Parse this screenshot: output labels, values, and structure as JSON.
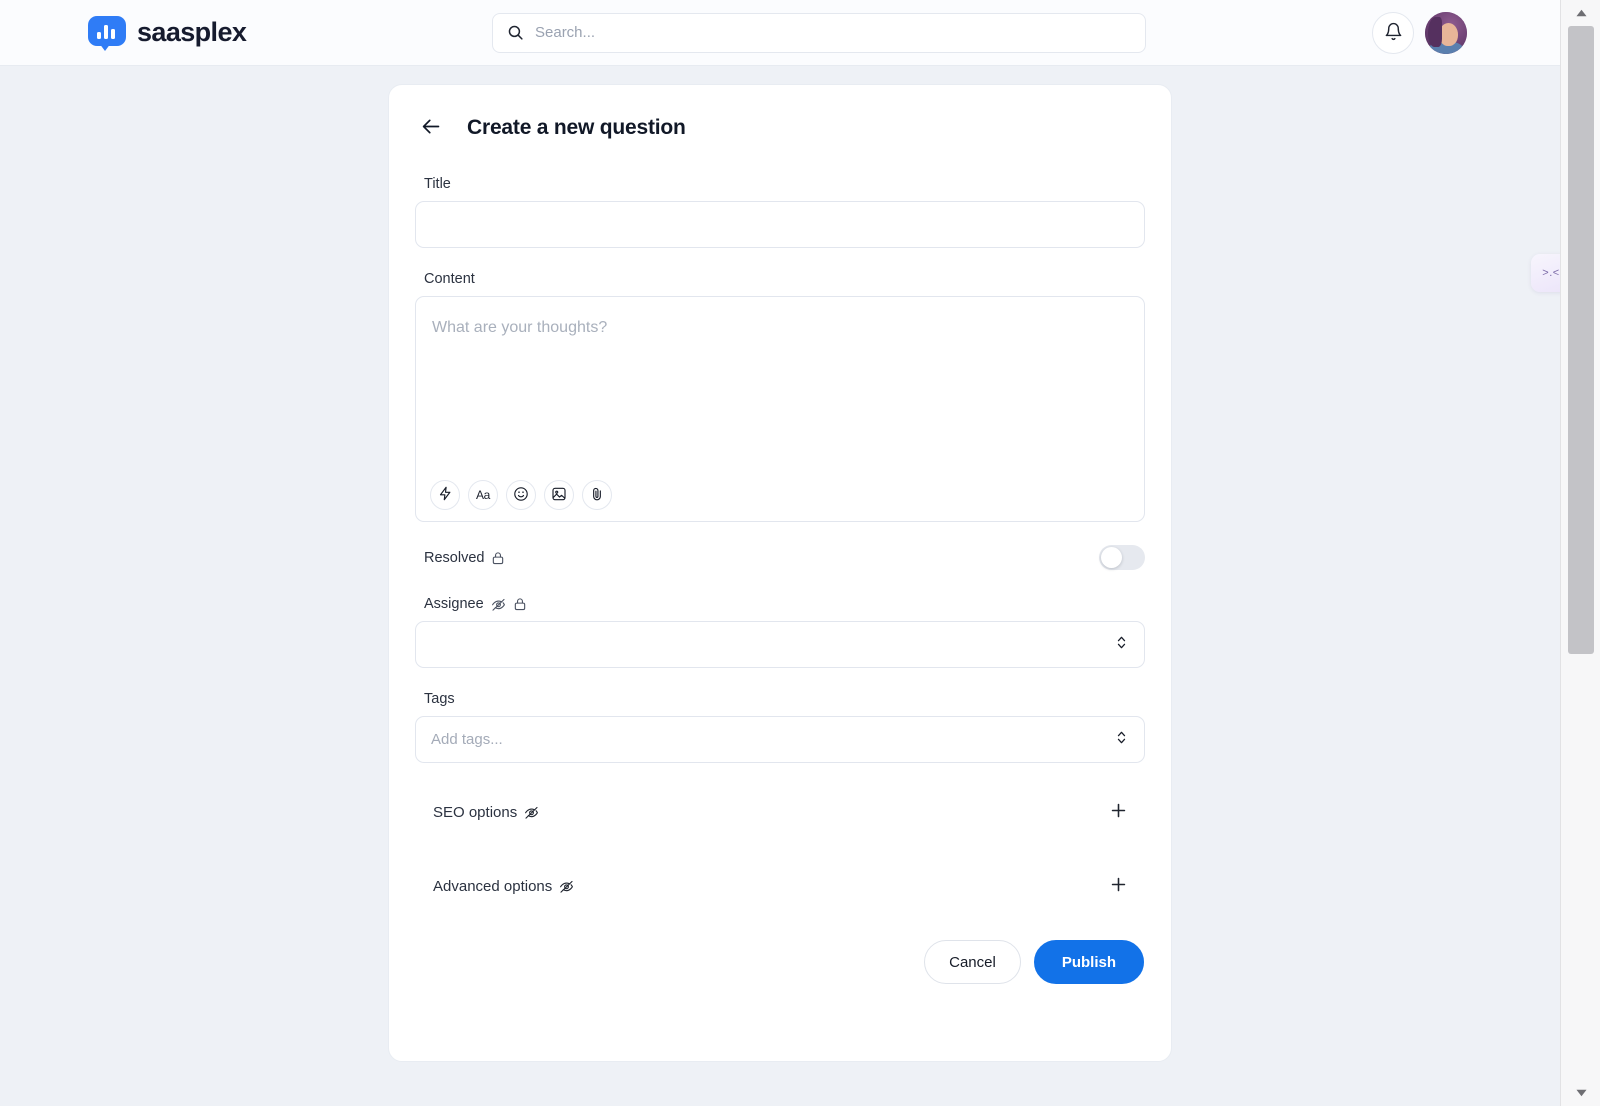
{
  "app": {
    "brand_name": "saasplex",
    "brand_icon": "bar-chart-bubble-logo",
    "accent_color": "#1272e8",
    "logo_color": "#2f7cf6",
    "page_background": "#eef1f6"
  },
  "topbar": {
    "search": {
      "icon": "search-icon",
      "placeholder": "Search...",
      "value": ""
    },
    "notifications": {
      "icon": "bell-icon",
      "label": "Notifications"
    },
    "avatar": {
      "icon": "user-avatar",
      "label": "Account"
    }
  },
  "card": {
    "back_icon": "arrow-left-icon",
    "title": "Create a new question",
    "title_field": {
      "label": "Title",
      "value": "",
      "placeholder": ""
    },
    "content_field": {
      "label": "Content",
      "value": "",
      "placeholder": "What are your thoughts?",
      "toolbar": [
        {
          "icon": "lightning-bolt-icon",
          "name": "quick-actions"
        },
        {
          "icon": "text-format-icon",
          "name": "text-format",
          "text": "Aa"
        },
        {
          "icon": "emoji-icon",
          "name": "insert-emoji"
        },
        {
          "icon": "image-icon",
          "name": "insert-image"
        },
        {
          "icon": "paperclip-icon",
          "name": "attach-file"
        }
      ]
    },
    "resolved": {
      "label": "Resolved",
      "icons": [
        "lock-icon"
      ],
      "toggle_state": "off"
    },
    "assignee": {
      "label": "Assignee",
      "icons": [
        "eye-off-icon",
        "lock-icon"
      ],
      "value": "",
      "placeholder": "",
      "chevrons_icon": "chevron-up-down-icon"
    },
    "tags": {
      "label": "Tags",
      "value": "",
      "placeholder": "Add tags...",
      "chevrons_icon": "chevron-up-down-icon"
    },
    "seo_options": {
      "label": "SEO options",
      "icons": [
        "eye-off-icon"
      ],
      "expand_icon": "plus-icon",
      "expanded": false
    },
    "advanced_options": {
      "label": "Advanced options",
      "icons": [
        "eye-off-icon"
      ],
      "expand_icon": "plus-icon",
      "expanded": false
    },
    "footer": {
      "cancel_label": "Cancel",
      "publish_label": "Publish"
    }
  },
  "side_tab": {
    "label": ">.<",
    "name": "feedback-tab"
  },
  "scrollbar": {
    "up_icon": "scroll-up-arrow",
    "down_icon": "scroll-down-arrow"
  }
}
